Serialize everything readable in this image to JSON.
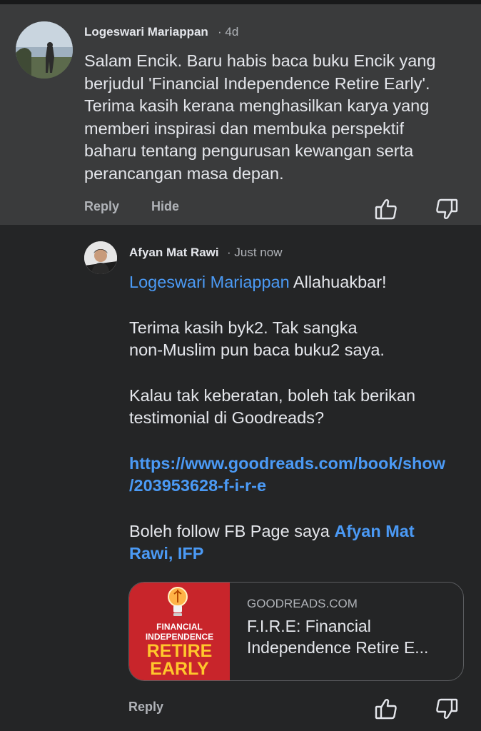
{
  "comment": {
    "author": "Logeswari Mariappan",
    "time": "· 4d",
    "text": "Salam Encik. Baru habis baca buku Encik yang\nberjudul 'Financial Independence Retire Early'.\nTerima kasih kerana menghasilkan karya yang\nmemberi inspirasi dan membuka perspektif\nbaharu tentang pengurusan kewangan serta\nperancangan masa depan.",
    "reply_label": "Reply",
    "hide_label": "Hide"
  },
  "reply": {
    "author": "Afyan Mat Rawi",
    "time": "· Just now",
    "mention": "Logeswari Mariappan",
    "line1_rest": " Allahuakbar!",
    "para2_a": "Terima kasih byk2. Tak sangka",
    "para2_b": "non-Muslim pun baca buku2 saya.",
    "para3_a": "Kalau tak keberatan, boleh tak berikan",
    "para3_b": "testimonial di Goodreads?",
    "link_a": "https://www.goodreads.com/book/show",
    "link_b": "/203953628-f-i-r-e",
    "para5_text": "Boleh follow FB Page saya ",
    "page_link_a": "Afyan Mat",
    "page_link_b": "Rawi, IFP",
    "reply_label": "Reply"
  },
  "link_card": {
    "source": "GOODREADS.COM",
    "title": "F.I.R.E: Financial Independence Retire E...",
    "cover_line1": "FINANCIAL",
    "cover_line2": "INDEPENDENCE",
    "cover_line3": "RETIRE",
    "cover_line4": "EARLY"
  },
  "colors": {
    "background": "#242526",
    "comment_highlight": "#3a3b3c",
    "link_blue": "#4b9af5",
    "muted_text": "#b0b3b8",
    "cover_red": "#c8252b",
    "cover_yellow": "#ffc72c"
  },
  "icons": {
    "like": "thumbs-up-icon",
    "dislike": "thumbs-down-icon"
  }
}
